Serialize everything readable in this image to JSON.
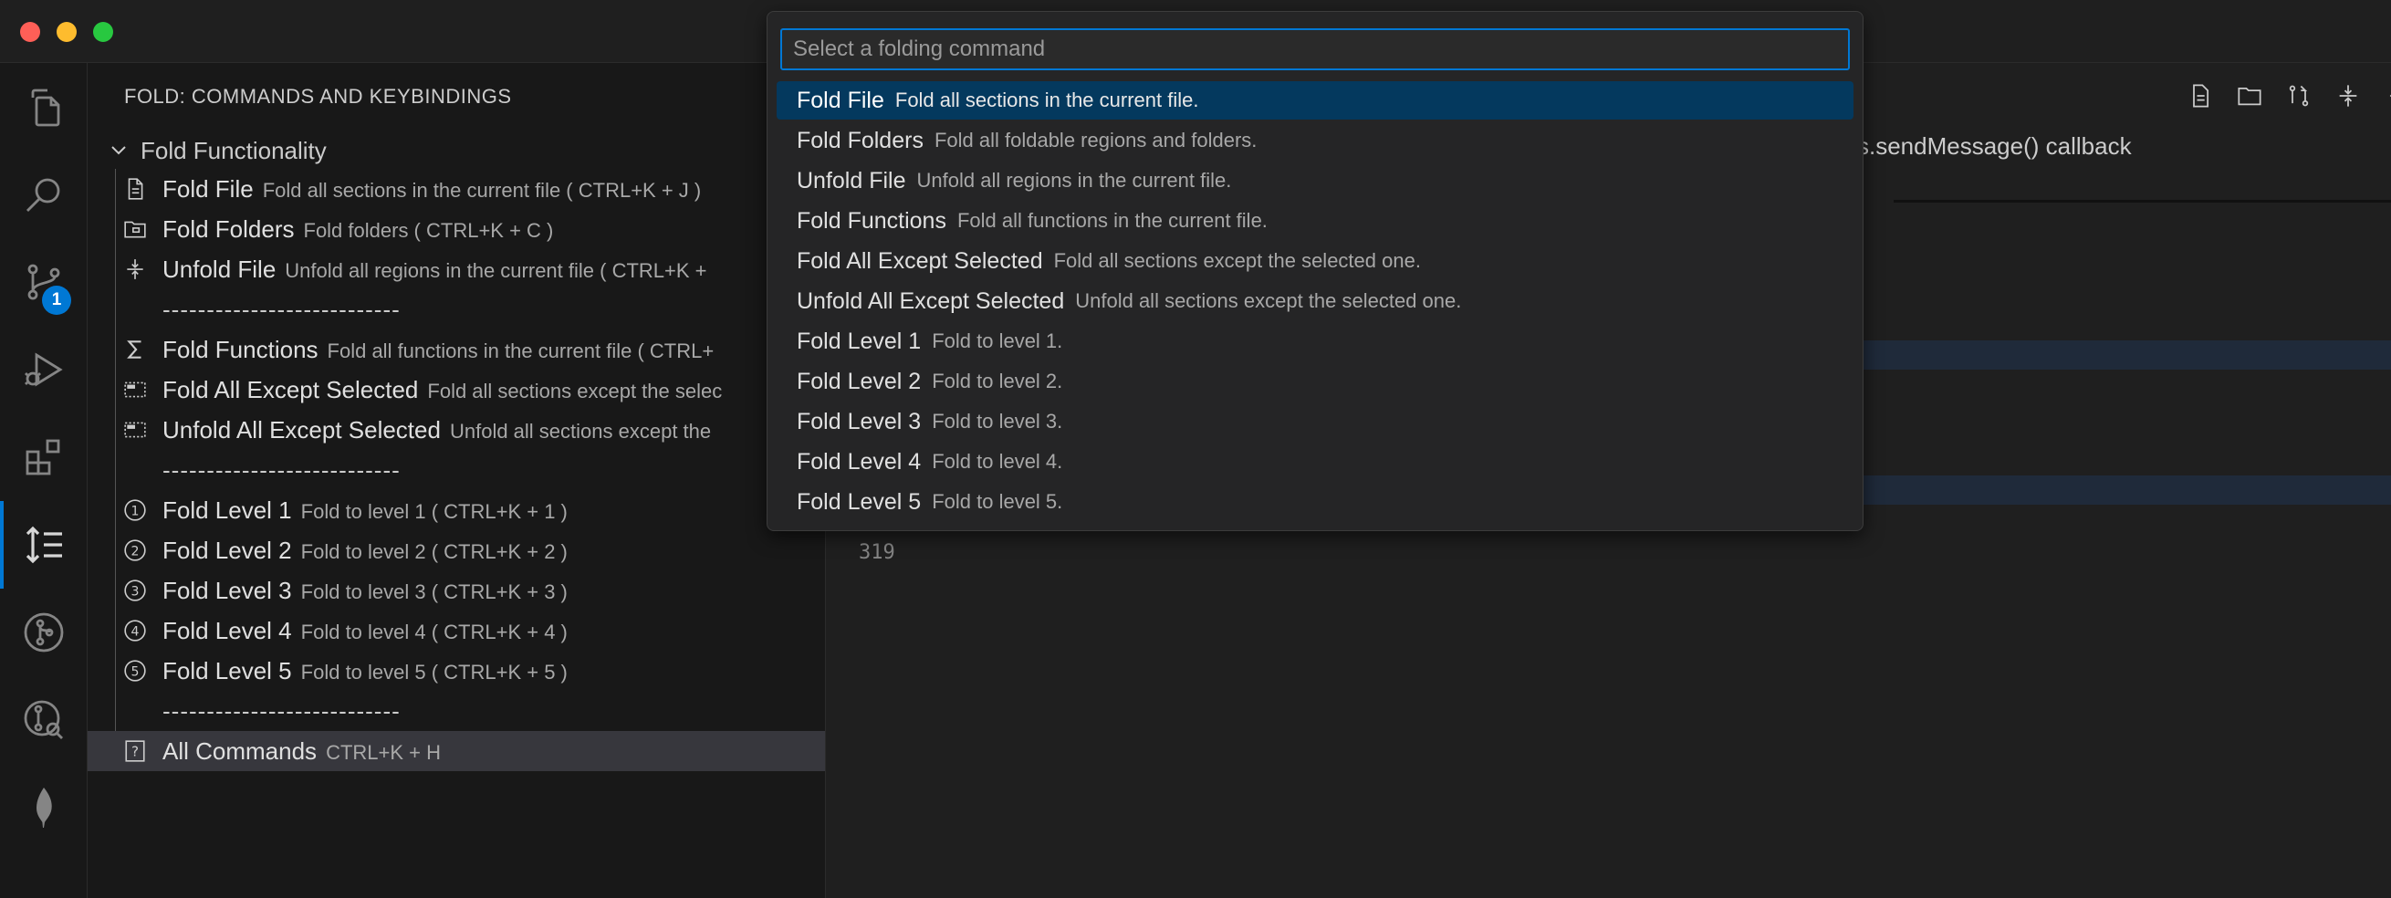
{
  "sidebar": {
    "title": "FOLD: COMMANDS AND KEYBINDINGS",
    "group_label": "Fold Functionality",
    "items": [
      {
        "label": "Fold File",
        "desc": "Fold all sections in the current file ( CTRL+K + J )",
        "icon": "file-icon"
      },
      {
        "label": "Fold Folders",
        "desc": "Fold folders ( CTRL+K + C )",
        "icon": "folder-icon"
      },
      {
        "label": "Unfold File",
        "desc": "Unfold all regions in the current file ( CTRL+K +",
        "icon": "unfold-icon"
      },
      {
        "label": "---------------------------",
        "desc": "",
        "icon": ""
      },
      {
        "label": "Fold Functions",
        "desc": "Fold all functions in the current file ( CTRL+",
        "icon": "sigma-icon"
      },
      {
        "label": "Fold All Except Selected",
        "desc": "Fold all sections except the selec",
        "icon": "selection-icon"
      },
      {
        "label": "Unfold All Except Selected",
        "desc": "Unfold all sections except the",
        "icon": "selection-icon"
      },
      {
        "label": "---------------------------",
        "desc": "",
        "icon": ""
      },
      {
        "label": "Fold Level 1",
        "desc": "Fold to level 1 ( CTRL+K + 1 )",
        "icon": "circled-1-icon"
      },
      {
        "label": "Fold Level 2",
        "desc": "Fold to level 2 ( CTRL+K + 2 )",
        "icon": "circled-2-icon"
      },
      {
        "label": "Fold Level 3",
        "desc": "Fold to level 3 ( CTRL+K + 3 )",
        "icon": "circled-3-icon"
      },
      {
        "label": "Fold Level 4",
        "desc": "Fold to level 4 ( CTRL+K + 4 )",
        "icon": "circled-4-icon"
      },
      {
        "label": "Fold Level 5",
        "desc": "Fold to level 5 ( CTRL+K + 5 )",
        "icon": "circled-5-icon"
      },
      {
        "label": "---------------------------",
        "desc": "",
        "icon": ""
      },
      {
        "label": "All Commands",
        "desc": "CTRL+K + H",
        "icon": "help-book-icon"
      }
    ]
  },
  "activity_bar": {
    "items": [
      "explorer-icon",
      "search-icon",
      "source-control-icon",
      "run-debug-icon",
      "extensions-icon",
      "fold-icon",
      "git-graph-icon",
      "git-lens-icon",
      "mongodb-leaf-icon"
    ],
    "source_control_badge": "1"
  },
  "editor": {
    "breadcrumb": "s.sendMessage() callback",
    "line_number": "319"
  },
  "quick_pick": {
    "placeholder": "Select a folding command",
    "items": [
      {
        "label": "Fold File",
        "desc": "Fold all sections in the current file."
      },
      {
        "label": "Fold Folders",
        "desc": "Fold all foldable regions and folders."
      },
      {
        "label": "Unfold File",
        "desc": "Unfold all regions in the current file."
      },
      {
        "label": "Fold Functions",
        "desc": "Fold all functions in the current file."
      },
      {
        "label": "Fold All Except Selected",
        "desc": "Fold all sections except the selected one."
      },
      {
        "label": "Unfold All Except Selected",
        "desc": "Unfold all sections except the selected one."
      },
      {
        "label": "Fold Level 1",
        "desc": "Fold to level 1."
      },
      {
        "label": "Fold Level 2",
        "desc": "Fold to level 2."
      },
      {
        "label": "Fold Level 3",
        "desc": "Fold to level 3."
      },
      {
        "label": "Fold Level 4",
        "desc": "Fold to level 4."
      },
      {
        "label": "Fold Level 5",
        "desc": "Fold to level 5."
      }
    ]
  },
  "colors": {
    "accent": "#0078d4",
    "selection": "#04395e",
    "close": "#ff5f57",
    "minimize": "#febc2e",
    "maximize": "#28c840"
  }
}
